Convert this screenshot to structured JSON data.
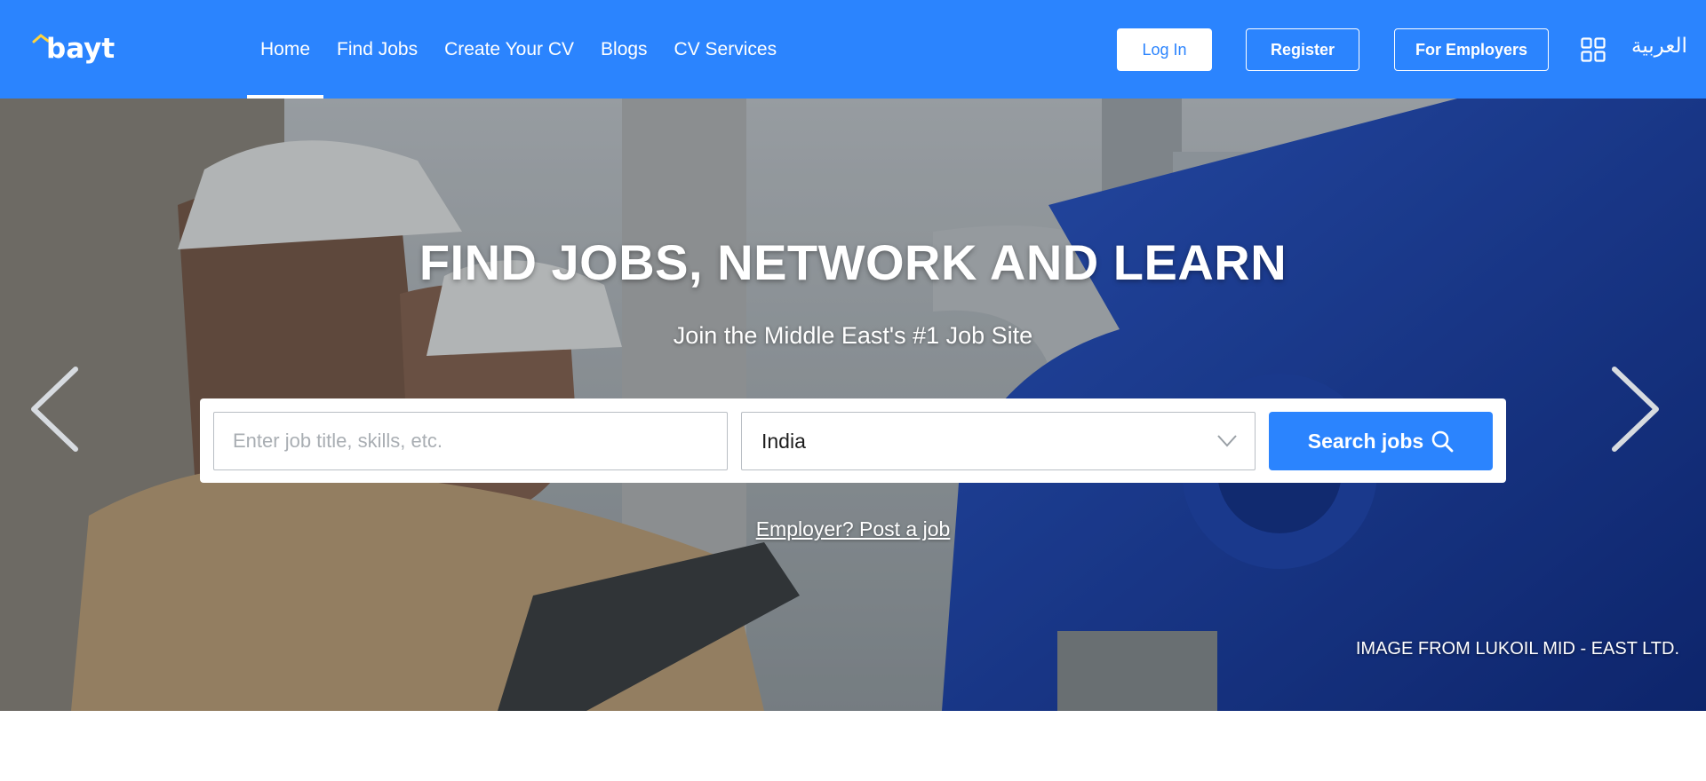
{
  "header": {
    "logo_text": "bayt",
    "nav": [
      {
        "label": "Home",
        "active": true
      },
      {
        "label": "Find Jobs",
        "active": false
      },
      {
        "label": "Create Your CV",
        "active": false
      },
      {
        "label": "Blogs",
        "active": false
      },
      {
        "label": "CV Services",
        "active": false
      }
    ],
    "login_label": "Log In",
    "register_label": "Register",
    "employers_label": "For Employers",
    "apps_icon": "grid-icon",
    "language_label": "العربية"
  },
  "hero": {
    "title": "FIND JOBS, NETWORK AND LEARN",
    "subtitle": "Join the Middle East's #1 Job Site",
    "search": {
      "job_placeholder": "Enter job title, skills, etc.",
      "job_value": "",
      "country_value": "India",
      "button_label": "Search jobs",
      "button_icon": "search-icon"
    },
    "employer_link": "Employer? Post a job",
    "image_credit": "IMAGE FROM LUKOIL MID - EAST LTD.",
    "prev_icon": "chevron-left-icon",
    "next_icon": "chevron-right-icon"
  },
  "colors": {
    "brand_blue": "#2b84fe",
    "white": "#ffffff"
  }
}
